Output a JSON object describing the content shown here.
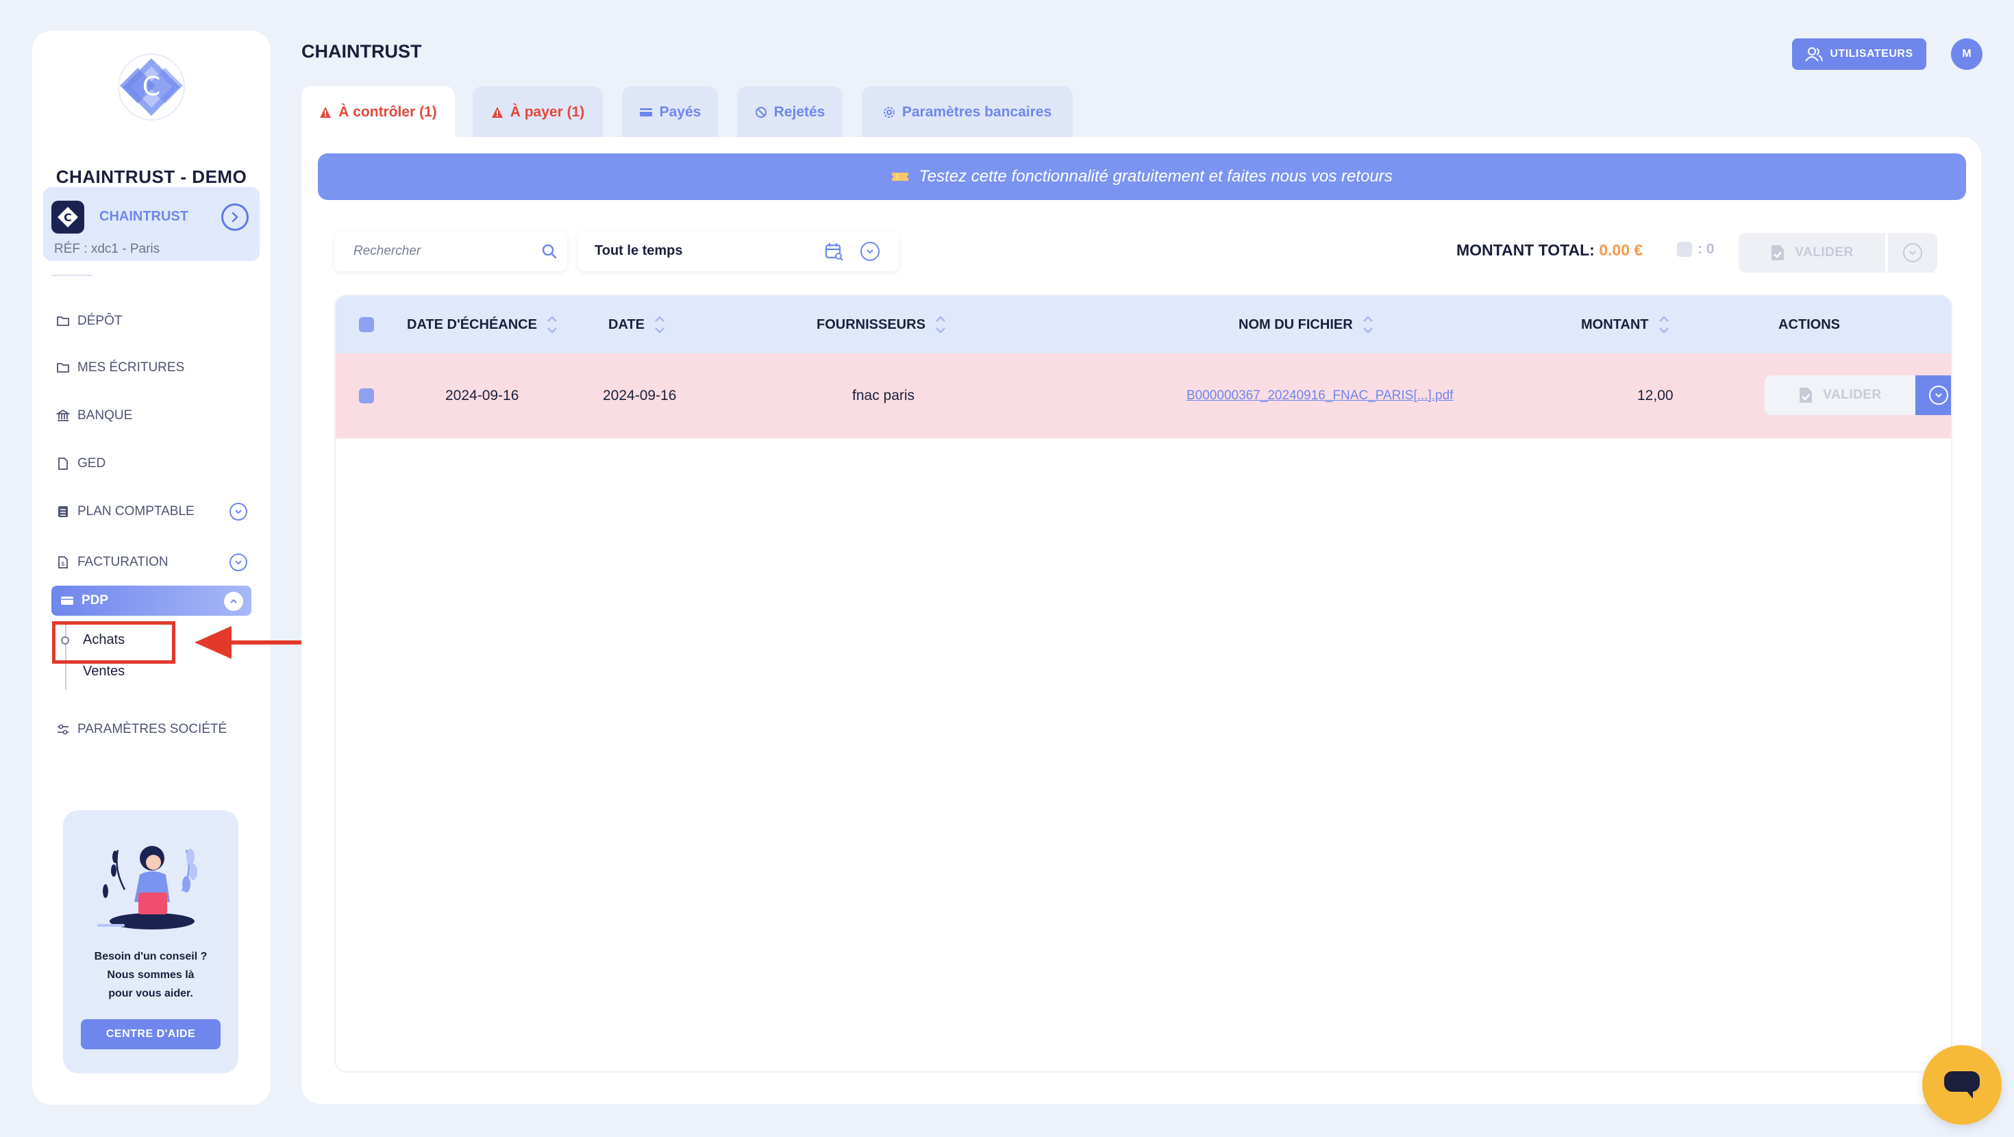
{
  "sidebar": {
    "company_name": "CHAINTRUST - DEMO",
    "account": {
      "name": "CHAINTRUST",
      "ref": "RÉF : xdc1 - Paris"
    },
    "nav": [
      {
        "label": "DÉPÔT",
        "icon": "folder-icon"
      },
      {
        "label": "MES ÉCRITURES",
        "icon": "folder-icon"
      },
      {
        "label": "BANQUE",
        "icon": "bank-icon"
      },
      {
        "label": "GED",
        "icon": "document-icon"
      },
      {
        "label": "PLAN COMPTABLE",
        "icon": "ledger-icon",
        "expandable": true
      },
      {
        "label": "FACTURATION",
        "icon": "invoice-icon",
        "expandable": true
      }
    ],
    "pdp": {
      "label": "PDP",
      "items": [
        {
          "label": "Achats",
          "active": true
        },
        {
          "label": "Ventes",
          "active": false
        }
      ]
    },
    "settings_label": "PARAMÈTRES SOCIÉTÉ",
    "help": {
      "line1": "Besoin d'un conseil ?",
      "line2": "Nous sommes là",
      "line3": "pour vous aider.",
      "button": "CENTRE D'AIDE"
    }
  },
  "header": {
    "title": "CHAINTRUST",
    "users_button": "UTILISATEURS",
    "avatar_initial": "M"
  },
  "tabs": [
    {
      "label": "À contrôler (1)",
      "icon": "warning-icon",
      "active": true
    },
    {
      "label": "À payer (1)",
      "icon": "warning-icon",
      "active": false
    },
    {
      "label": "Payés",
      "icon": "card-icon",
      "active": false
    },
    {
      "label": "Rejetés",
      "icon": "ban-icon",
      "active": false
    },
    {
      "label": "Paramètres bancaires",
      "icon": "gear-icon",
      "active": false
    }
  ],
  "banner": {
    "text": "Testez cette fonctionnalité gratuitement et faites nous vos retours",
    "icon": "ticket-icon"
  },
  "toolbar": {
    "search_placeholder": "Rechercher",
    "search_value": "",
    "period": "Tout le temps",
    "total_label": "MONTANT TOTAL:",
    "total_value": "0.00 €",
    "selected_count": ": 0",
    "validate_label": "VALIDER"
  },
  "table": {
    "columns": [
      "DATE D'ÉCHÉANCE",
      "DATE",
      "FOURNISSEURS",
      "NOM DU FICHIER",
      "MONTANT",
      "ACTIONS"
    ],
    "rows": [
      {
        "due_date": "2024-09-16",
        "date": "2024-09-16",
        "supplier": "fnac paris",
        "file_name": "B000000367_20240916_FNAC_PARIS[...].pdf",
        "amount": "12,00",
        "action_label": "VALIDER",
        "status_color": "#f9dde2"
      }
    ]
  },
  "colors": {
    "accent": "#6f86ec",
    "warning": "#e2473a",
    "total": "#f39a4b",
    "chat": "#f6b938"
  }
}
